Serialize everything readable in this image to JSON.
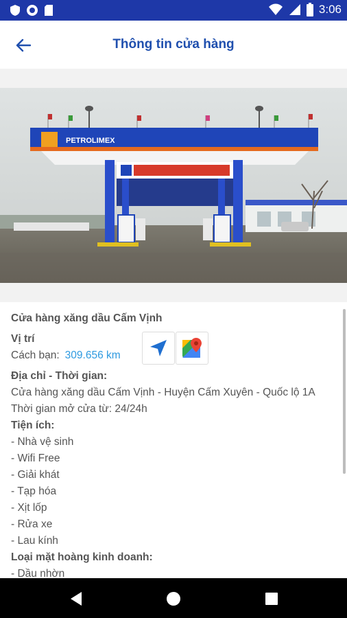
{
  "status_bar": {
    "time": "3:06"
  },
  "app_bar": {
    "title": "Thông tin cửa hàng",
    "back_icon": "arrow-left-icon"
  },
  "photo": {
    "sign_brand": "PETROLIMEX"
  },
  "store": {
    "name": "Cửa hàng xăng dầu Cấm Vịnh",
    "location_title": "Vị trí",
    "distance_label": "Cách bạn:",
    "distance_value": "309.656 km",
    "address_title": "Địa chỉ - Thời gian:",
    "address": "Cửa hàng xăng dầu Cấm Vịnh - Huyện Cấm Xuyên - Quốc lộ 1A",
    "hours": "Thời gian mở cửa từ: 24/24h",
    "amenities_title": "Tiện ích:",
    "amenities": [
      "- Nhà vệ sinh",
      "- Wifi Free",
      "- Giải khát",
      "- Tạp hóa",
      "- Xịt lốp",
      "- Rửa xe",
      "- Lau kính"
    ],
    "business_title": "Loại mặt hoàng kinh doanh:",
    "business_items": [
      "- Dầu nhờn"
    ]
  },
  "colors": {
    "status_bar": "#1e38a8",
    "title": "#1f4fae",
    "distance": "#2e9ae0",
    "nav_icon": "#1f6fd0"
  }
}
